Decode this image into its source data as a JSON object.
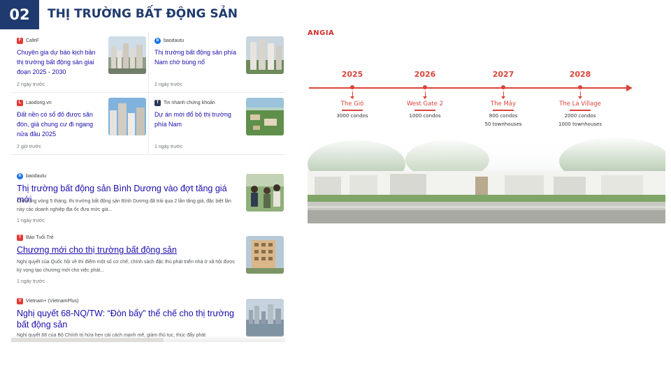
{
  "header": {
    "number": "02",
    "title": "THỊ TRƯỜNG BẤT ĐỘNG SẢN"
  },
  "cards": [
    {
      "source": "CafeF",
      "icon": "cafef-icon",
      "title": "Chuyên gia dự báo kịch bản thị trường bất động sản giai đoạn 2025 - 2030",
      "time": "2 ngày trước"
    },
    {
      "source": "baodautu",
      "icon": "baodautu-icon",
      "title": "Thị trường bất động sản phía Nam chờ bùng nổ",
      "time": "2 ngày trước"
    },
    {
      "source": "Laodong.vn",
      "icon": "laodong-icon",
      "title": "Đất nền có sổ đỏ được săn đón, giá chung cư đi ngang nửa đầu 2025",
      "time": "2 giờ trước"
    },
    {
      "source": "Tin nhanh chứng khoán",
      "icon": "tinnhanh-icon",
      "title": "Dự án mới đổ bộ thị trường phía Nam",
      "time": "1 ngày trước"
    }
  ],
  "items": [
    {
      "source": "baodautu",
      "icon": "baodautu-icon",
      "title": "Thị trường bất động sản Bình Dương vào đợt tăng giá mới",
      "snippet": "Chỉ trong vòng 5 tháng, thị trường bất động sản Bình Dương đã trải qua 2 lần tăng giá, đặc biệt lần này các doanh nghiệp địa ốc đưa mức giá...",
      "time": "1 ngày trước"
    },
    {
      "source": "Báo Tuổi Trẻ",
      "icon": "tuoitre-icon",
      "title": "Chương mới cho thị trường bất động sản",
      "snippet": "Nghị quyết của Quốc hội về thí điểm một số cơ chế, chính sách đặc thù phát triển nhà ở xã hội được kỳ vọng tạo chương mới cho việc phát...",
      "time": "1 ngày trước"
    },
    {
      "source": "Vietnam+ (VietnamPlus)",
      "icon": "vietnamplus-icon",
      "title": "Nghị quyết 68-NQ/TW: “Đòn bẩy” thể chế cho thị trường bất động sản",
      "snippet": "Nghị quyết 68 của Bộ Chính trị hứa hẹn cải cách mạnh mẽ, giảm thủ tục, thúc đẩy phát",
      "time": ""
    }
  ],
  "timeline": {
    "logo": "ANGIA",
    "milestones": [
      {
        "year": "2025",
        "name": "The Gió",
        "line1": "3000 condos",
        "line2": ""
      },
      {
        "year": "2026",
        "name": "West Gate 2",
        "line1": "1000 condos",
        "line2": ""
      },
      {
        "year": "2027",
        "name": "The Mây",
        "line1": "800 condos",
        "line2": "50 townhouses"
      },
      {
        "year": "2028",
        "name": "The Lá Village",
        "line1": "2000 condos",
        "line2": "1000 townhouses"
      }
    ]
  },
  "colors": {
    "navy": "#1f3a6e",
    "brand_red": "#d9453b",
    "link_blue": "#1a0dab"
  }
}
